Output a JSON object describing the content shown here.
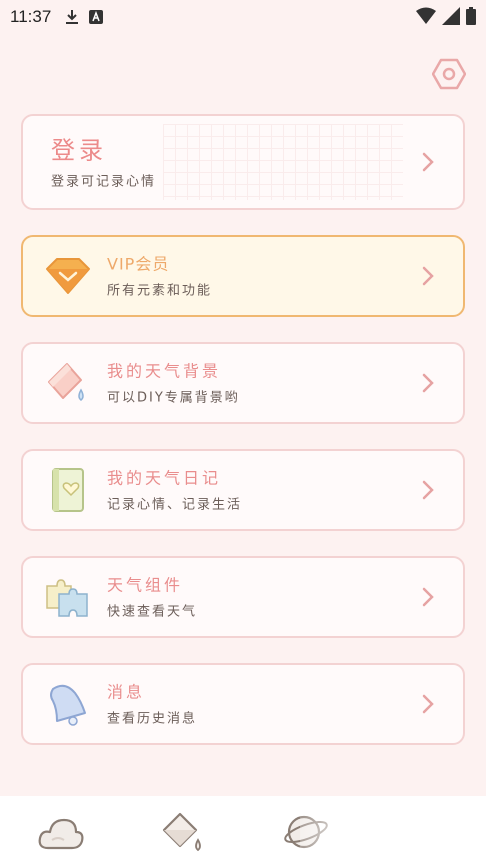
{
  "status": {
    "time": "11:37"
  },
  "login": {
    "title": "登录",
    "subtitle": "登录可记录心情"
  },
  "menu": [
    {
      "id": "vip",
      "title": "VIP会员",
      "subtitle": "所有元素和功能",
      "icon": "diamond-icon"
    },
    {
      "id": "background",
      "title": "我的天气背景",
      "subtitle": "可以DIY专属背景哟",
      "icon": "paint-bucket-icon"
    },
    {
      "id": "diary",
      "title": "我的天气日记",
      "subtitle": "记录心情、记录生活",
      "icon": "diary-book-icon"
    },
    {
      "id": "widget",
      "title": "天气组件",
      "subtitle": "快速查看天气",
      "icon": "puzzle-icon"
    },
    {
      "id": "messages",
      "title": "消息",
      "subtitle": "查看历史消息",
      "icon": "bell-icon"
    }
  ],
  "bottom_nav": [
    {
      "id": "weather",
      "icon": "cloud-icon"
    },
    {
      "id": "skin",
      "icon": "paint-bucket-icon"
    },
    {
      "id": "mine",
      "icon": "planet-icon"
    }
  ],
  "colors": {
    "background": "#fdf2f1",
    "card_border": "#f3d2d2",
    "title_pink": "#e98d8d",
    "vip_border": "#f0b871",
    "vip_title": "#eea96a"
  }
}
